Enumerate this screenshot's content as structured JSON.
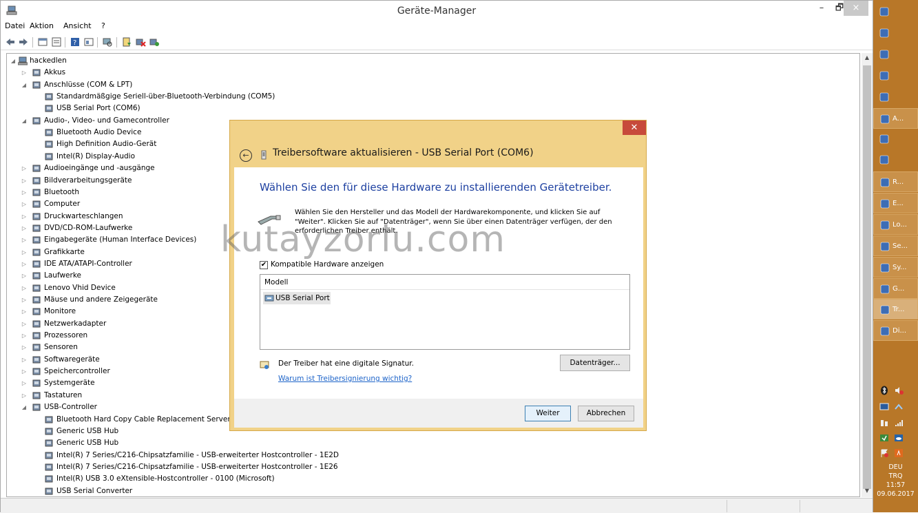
{
  "window": {
    "title": "Geräte-Manager",
    "caption_buttons": {
      "minimize": "–",
      "maximize": "🗗",
      "close": "×"
    }
  },
  "menu": [
    "Datei",
    "Aktion",
    "Ansicht",
    "?"
  ],
  "toolbar": [
    "back-icon",
    "forward-icon",
    "properties-icon",
    "view-icon",
    "help-icon",
    "show-hidden-icon",
    "scan-hardware-icon",
    "update-driver-icon",
    "uninstall-icon",
    "enable-icon"
  ],
  "tree": {
    "root": "hackedlen",
    "items": [
      {
        "label": "Akkus",
        "expander": "closed",
        "level": 1
      },
      {
        "label": "Anschlüsse (COM & LPT)",
        "expander": "open",
        "level": 1
      },
      {
        "label": "Standardmäßgige Seriell-über-Bluetooth-Verbindung (COM5)",
        "level": 2
      },
      {
        "label": "USB Serial Port (COM6)",
        "level": 2
      },
      {
        "label": "Audio-, Video- und Gamecontroller",
        "expander": "open",
        "level": 1
      },
      {
        "label": "Bluetooth Audio Device",
        "level": 2
      },
      {
        "label": "High Definition Audio-Gerät",
        "level": 2
      },
      {
        "label": "Intel(R) Display-Audio",
        "level": 2
      },
      {
        "label": "Audioeingänge und -ausgänge",
        "expander": "closed",
        "level": 1
      },
      {
        "label": "Bildverarbeitungsgeräte",
        "expander": "closed",
        "level": 1
      },
      {
        "label": "Bluetooth",
        "expander": "closed",
        "level": 1
      },
      {
        "label": "Computer",
        "expander": "closed",
        "level": 1
      },
      {
        "label": "Druckwarteschlangen",
        "expander": "closed",
        "level": 1
      },
      {
        "label": "DVD/CD-ROM-Laufwerke",
        "expander": "closed",
        "level": 1
      },
      {
        "label": "Eingabegeräte (Human Interface Devices)",
        "expander": "closed",
        "level": 1
      },
      {
        "label": "Grafikkarte",
        "expander": "closed",
        "level": 1
      },
      {
        "label": "IDE ATA/ATAPI-Controller",
        "expander": "closed",
        "level": 1
      },
      {
        "label": "Laufwerke",
        "expander": "closed",
        "level": 1
      },
      {
        "label": "Lenovo Vhid Device",
        "expander": "closed",
        "level": 1
      },
      {
        "label": "Mäuse und andere Zeigegeräte",
        "expander": "closed",
        "level": 1
      },
      {
        "label": "Monitore",
        "expander": "closed",
        "level": 1
      },
      {
        "label": "Netzwerkadapter",
        "expander": "closed",
        "level": 1
      },
      {
        "label": "Prozessoren",
        "expander": "closed",
        "level": 1
      },
      {
        "label": "Sensoren",
        "expander": "closed",
        "level": 1
      },
      {
        "label": "Softwaregeräte",
        "expander": "closed",
        "level": 1
      },
      {
        "label": "Speichercontroller",
        "expander": "closed",
        "level": 1
      },
      {
        "label": "Systemgeräte",
        "expander": "closed",
        "level": 1
      },
      {
        "label": "Tastaturen",
        "expander": "closed",
        "level": 1
      },
      {
        "label": "USB-Controller",
        "expander": "open",
        "level": 1
      },
      {
        "label": "Bluetooth Hard Copy Cable Replacement Server",
        "level": 2
      },
      {
        "label": "Generic USB Hub",
        "level": 2
      },
      {
        "label": "Generic USB Hub",
        "level": 2
      },
      {
        "label": "Intel(R) 7 Series/C216-Chipsatzfamilie - USB-erweiterter Hostcontroller - 1E2D",
        "level": 2
      },
      {
        "label": "Intel(R) 7 Series/C216-Chipsatzfamilie - USB-erweiterter Hostcontroller - 1E26",
        "level": 2
      },
      {
        "label": "Intel(R) USB 3.0 eXtensible-Hostcontroller - 0100 (Microsoft)",
        "level": 2
      },
      {
        "label": "USB Serial Converter",
        "level": 2
      }
    ]
  },
  "dialog": {
    "title": "Treibersoftware aktualisieren - USB Serial Port (COM6)",
    "heading": "Wählen Sie den für diese Hardware zu installierenden Gerätetreiber.",
    "description": "Wählen Sie den Hersteller und das Modell der Hardwarekomponente, und klicken Sie auf \"Weiter\". Klicken Sie auf \"Datenträger\", wenn Sie über einen Datenträger verfügen, der den erforderlichen Treiber enthält.",
    "watermark": "kutayzorlu.com",
    "checkbox_label": "Kompatible Hardware anzeigen",
    "checkbox_checked": true,
    "list_header": "Modell",
    "list_items": [
      "USB Serial Port"
    ],
    "signature_text": "Der Treiber hat eine digitale Signatur.",
    "signature_link": "Warum ist Treibersignierung wichtig?",
    "disk_button": "Datenträger...",
    "next_button": "Weiter",
    "cancel_button": "Abbrechen",
    "close_glyph": "✕"
  },
  "taskbar": {
    "buttons": [
      {
        "label": "",
        "icon": "windows-icon"
      },
      {
        "label": "",
        "icon": "monitor-icon"
      },
      {
        "label": "",
        "icon": "folder-icon"
      },
      {
        "label": "",
        "icon": "ie-icon"
      },
      {
        "label": "",
        "icon": "opera-icon"
      },
      {
        "label": "A...",
        "icon": "chrome-icon"
      },
      {
        "label": "",
        "icon": "firefox-icon"
      },
      {
        "label": "",
        "icon": "vb-icon"
      },
      {
        "label": "R...",
        "icon": "remote-icon"
      },
      {
        "label": "E...",
        "icon": "console-icon"
      },
      {
        "label": "Lo...",
        "icon": "log-icon"
      },
      {
        "label": "Se...",
        "icon": "globe-icon"
      },
      {
        "label": "Sy...",
        "icon": "system-icon"
      },
      {
        "label": "G...",
        "icon": "device-manager-icon"
      },
      {
        "label": "Tr...",
        "icon": "usb-icon"
      },
      {
        "label": "Di...",
        "icon": "search-icon"
      }
    ],
    "clock": {
      "layout": "DEU",
      "keyboard": "TRQ",
      "time": "11:57",
      "date": "09.06.2017"
    }
  }
}
